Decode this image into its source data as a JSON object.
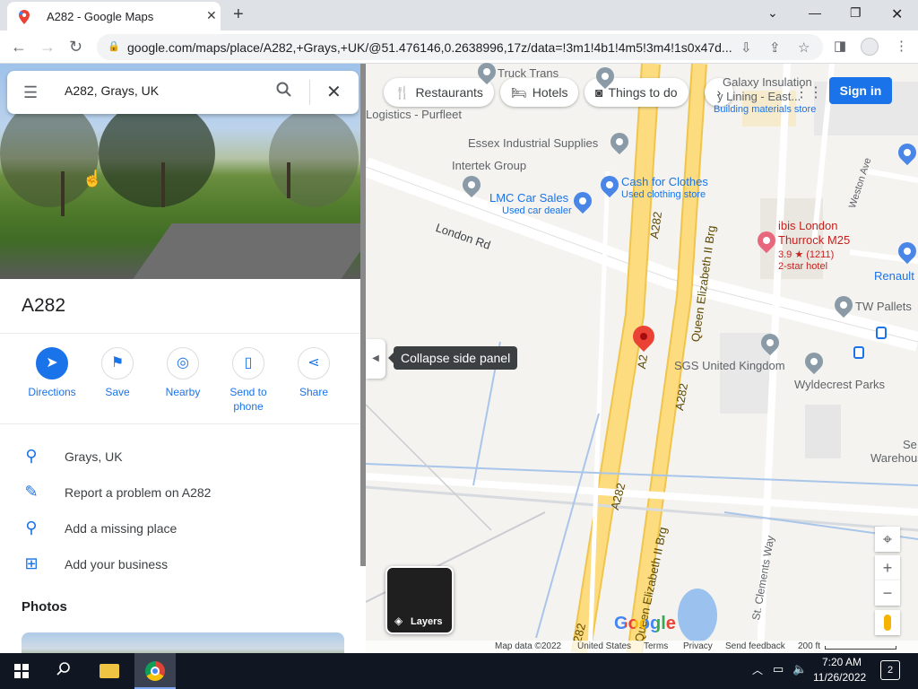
{
  "browser": {
    "tab_title": "A282 - Google Maps",
    "url": "google.com/maps/place/A282,+Grays,+UK/@51.476146,0.2638996,17z/data=!3m1!4b1!4m5!3m4!1s0x47d..."
  },
  "search": {
    "value": "A282, Grays, UK"
  },
  "place": {
    "title": "A282",
    "actions": [
      {
        "label": "Directions",
        "icon": "directions-icon"
      },
      {
        "label": "Save",
        "icon": "bookmark-icon"
      },
      {
        "label": "Nearby",
        "icon": "nearby-icon"
      },
      {
        "label": "Send to phone",
        "icon": "send-to-phone-icon"
      },
      {
        "label": "Share",
        "icon": "share-icon"
      }
    ],
    "info_rows": [
      {
        "text": "Grays, UK",
        "icon": "location-pin-icon"
      },
      {
        "text": "Report a problem on A282",
        "icon": "pencil-icon"
      },
      {
        "text": "Add a missing place",
        "icon": "add-place-icon"
      },
      {
        "text": "Add your business",
        "icon": "add-business-icon"
      }
    ],
    "photos_title": "Photos"
  },
  "map": {
    "chips": [
      "Restaurants",
      "Hotels",
      "Things to do"
    ],
    "sign_in": "Sign in",
    "collapse_tooltip": "Collapse side panel",
    "layers_label": "Layers",
    "logo": "Google",
    "labels": {
      "truck_trans": "Truck Trans",
      "galaxy": "Galaxy Insulation",
      "galaxy2": "y Lining - East...",
      "galaxy_sub": "Building materials store",
      "logistics": "Logistics - Purfleet",
      "essex": "Essex Industrial Supplies",
      "intertek": "Intertek Group",
      "cash": "Cash for Clothes",
      "cash_sub": "Used clothing store",
      "lmc": "LMC Car Sales",
      "lmc_sub": "Used car dealer",
      "london_rd": "London Rd",
      "a282_top": "A282",
      "a282_mid": "A2",
      "a282_low": "A282",
      "a282_low2": "A282",
      "a282_bottom": "282",
      "qe_top": "Queen Elizabeth II Brg",
      "qe_bottom": "Queen Elizabeth II Brg",
      "ibis": "ibis London",
      "ibis2": "Thurrock M25",
      "ibis_rating": "3.9 ★ (1211)",
      "ibis_sub": "2-star hotel",
      "weston": "Weston Ave",
      "renault": "Renault",
      "tw": "TW Pallets",
      "sgs": "SGS United Kingdom",
      "wyldecrest": "Wyldecrest Parks",
      "se": "Se",
      "warehousing": "Warehousing",
      "st_clements": "St. Clements Way"
    },
    "footer": {
      "map_data": "Map data ©2022",
      "country": "United States",
      "terms": "Terms",
      "privacy": "Privacy",
      "feedback": "Send feedback",
      "scale": "200 ft"
    }
  },
  "taskbar": {
    "time": "7:20 AM",
    "date": "11/26/2022",
    "notifications": "2"
  }
}
